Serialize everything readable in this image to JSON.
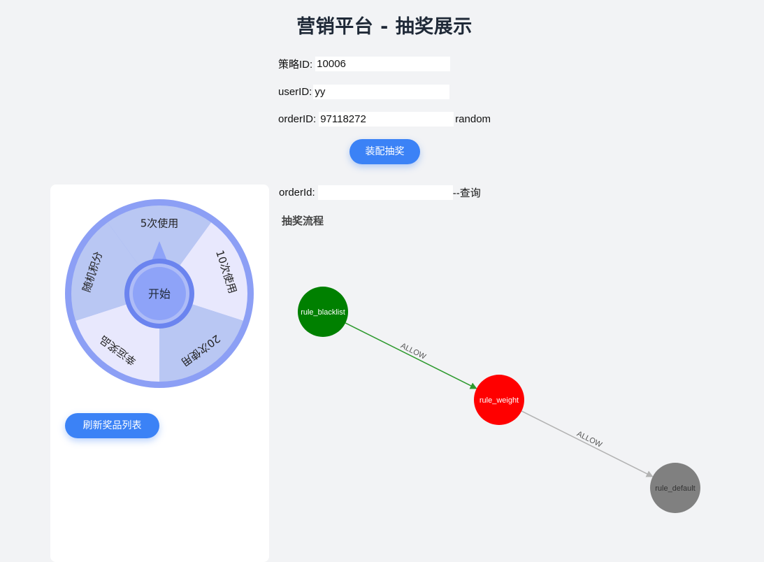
{
  "title": "营销平台 - 抽奖展示",
  "form": {
    "strategy_label": "策略ID:",
    "strategy_value": "10006",
    "user_label": "userID:",
    "user_value": "yy",
    "order_label": "orderID:",
    "order_value": "97118272",
    "random_label": "random",
    "assemble_button": "装配抽奖"
  },
  "query": {
    "label": "orderId:",
    "value": "",
    "action": "--查询"
  },
  "wheel": {
    "prizes": [
      "5次使用",
      "10次使用",
      "20次使用",
      "幸运奖品",
      "随机积分"
    ],
    "start_label": "开始",
    "colors": {
      "ring": "#8c9ff5",
      "slice_dark": "#b9c7f3",
      "slice_light": "#e8e8fd",
      "pointer": "#8ea3f8",
      "hub_ring": "#6b84ef"
    }
  },
  "refresh_button": "刷新奖品列表",
  "flow": {
    "title": "抽奖流程",
    "nodes": [
      {
        "id": "rule_blacklist",
        "label": "rule_blacklist",
        "color": "#008000"
      },
      {
        "id": "rule_weight",
        "label": "rule_weight",
        "color": "#ff0000"
      },
      {
        "id": "rule_default",
        "label": "rule_default",
        "color": "#808080"
      }
    ],
    "edges": [
      {
        "from": "rule_blacklist",
        "to": "rule_weight",
        "label": "ALLOW",
        "color": "#2e9a2e"
      },
      {
        "from": "rule_weight",
        "to": "rule_default",
        "label": "ALLOW",
        "color": "#b3b3b3"
      }
    ]
  }
}
